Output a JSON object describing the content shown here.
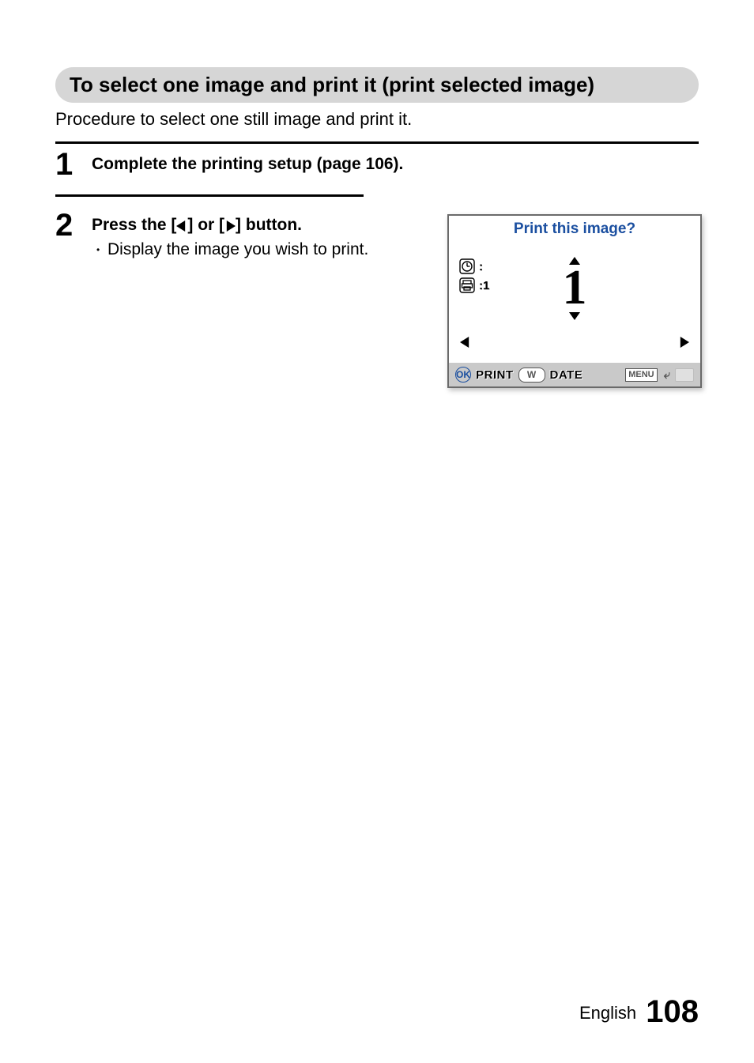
{
  "section_title": "To select one image and print it (print selected image)",
  "intro": "Procedure to select one still image and print it.",
  "steps": {
    "1": {
      "title": "Complete the printing setup (page 106)."
    },
    "2": {
      "title_pre": "Press the [",
      "title_mid": "] or [",
      "title_post": "] button.",
      "bullet": "Display the image you wish to print."
    }
  },
  "lcd": {
    "title": "Print this image?",
    "clock_value": ":",
    "print_value": ":1",
    "big_number": "1",
    "bottom": {
      "ok_label": "OK",
      "print_label": "PRINT",
      "w_label": "W",
      "date_label": "DATE",
      "menu_label": "MENU"
    }
  },
  "footer": {
    "lang": "English",
    "page_number": "108"
  }
}
